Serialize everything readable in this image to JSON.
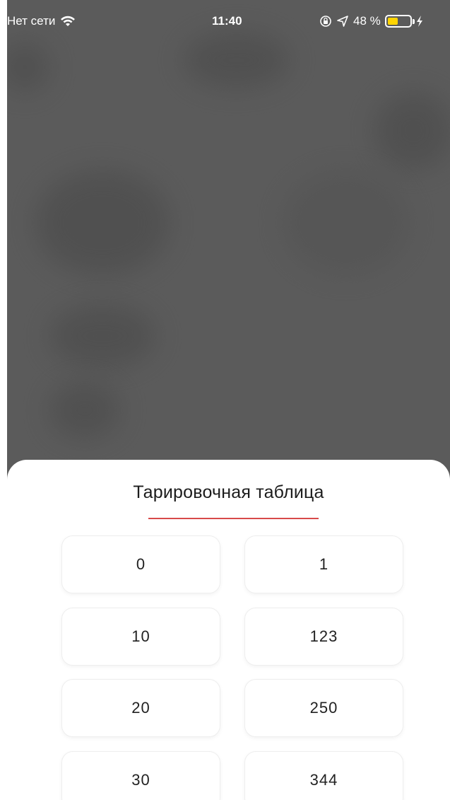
{
  "status_bar": {
    "carrier": "Нет сети",
    "time": "11:40",
    "battery_percent": "48 %",
    "battery_level": 0.48,
    "battery_color": "#ffd400"
  },
  "sheet": {
    "title": "Тарировочная таблица",
    "accent_color": "#d84a4a",
    "rows": [
      {
        "left": "0",
        "right": "1"
      },
      {
        "left": "10",
        "right": "123"
      },
      {
        "left": "20",
        "right": "250"
      },
      {
        "left": "30",
        "right": "344"
      }
    ]
  },
  "icons": [
    "wifi-icon",
    "orientation-lock-icon",
    "location-icon",
    "battery-icon",
    "charging-icon"
  ]
}
